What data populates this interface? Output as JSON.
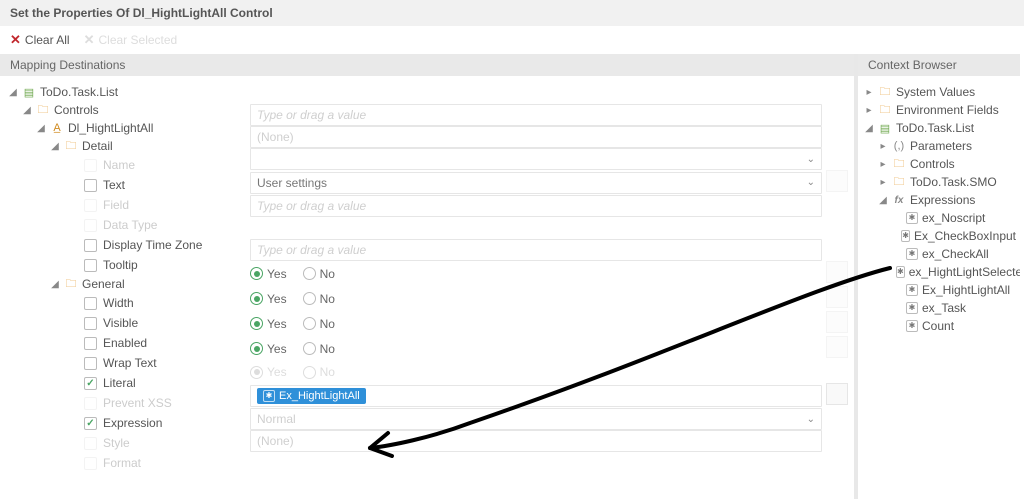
{
  "title": "Set the Properties Of Dl_HightLightAll Control",
  "toolbar": {
    "clear_all": "Clear All",
    "clear_selected": "Clear Selected"
  },
  "sections": {
    "mapping": "Mapping Destinations",
    "context": "Context Browser"
  },
  "tree": {
    "root": "ToDo.Task.List",
    "controls": "Controls",
    "ctrl": "Dl_HightLightAll",
    "detail": "Detail",
    "general": "General",
    "props": {
      "name": "Name",
      "text": "Text",
      "field": "Field",
      "datatype": "Data Type",
      "dtz": "Display Time Zone",
      "tooltip": "Tooltip",
      "width": "Width",
      "visible": "Visible",
      "enabled": "Enabled",
      "wrap": "Wrap Text",
      "literal": "Literal",
      "prevent": "Prevent XSS",
      "expression": "Expression",
      "style": "Style",
      "format": "Format"
    }
  },
  "form": {
    "placeholder": "Type or drag a value",
    "none": "(None)",
    "user_settings": "User settings",
    "yes": "Yes",
    "no": "No",
    "normal": "Normal",
    "expr_tag": "Ex_HightLightAll"
  },
  "context": {
    "system_values": "System Values",
    "env_fields": "Environment Fields",
    "root": "ToDo.Task.List",
    "parameters": "Parameters",
    "controls": "Controls",
    "smo": "ToDo.Task.SMO",
    "expressions": "Expressions",
    "exprs": {
      "noscript": "ex_Noscript",
      "chkinput": "Ex_CheckBoxInput",
      "chkall": "ex_CheckAll",
      "hlsel": "ex_HightLightSelected",
      "hlall": "Ex_HightLightAll",
      "task": "ex_Task",
      "count": "Count"
    }
  }
}
